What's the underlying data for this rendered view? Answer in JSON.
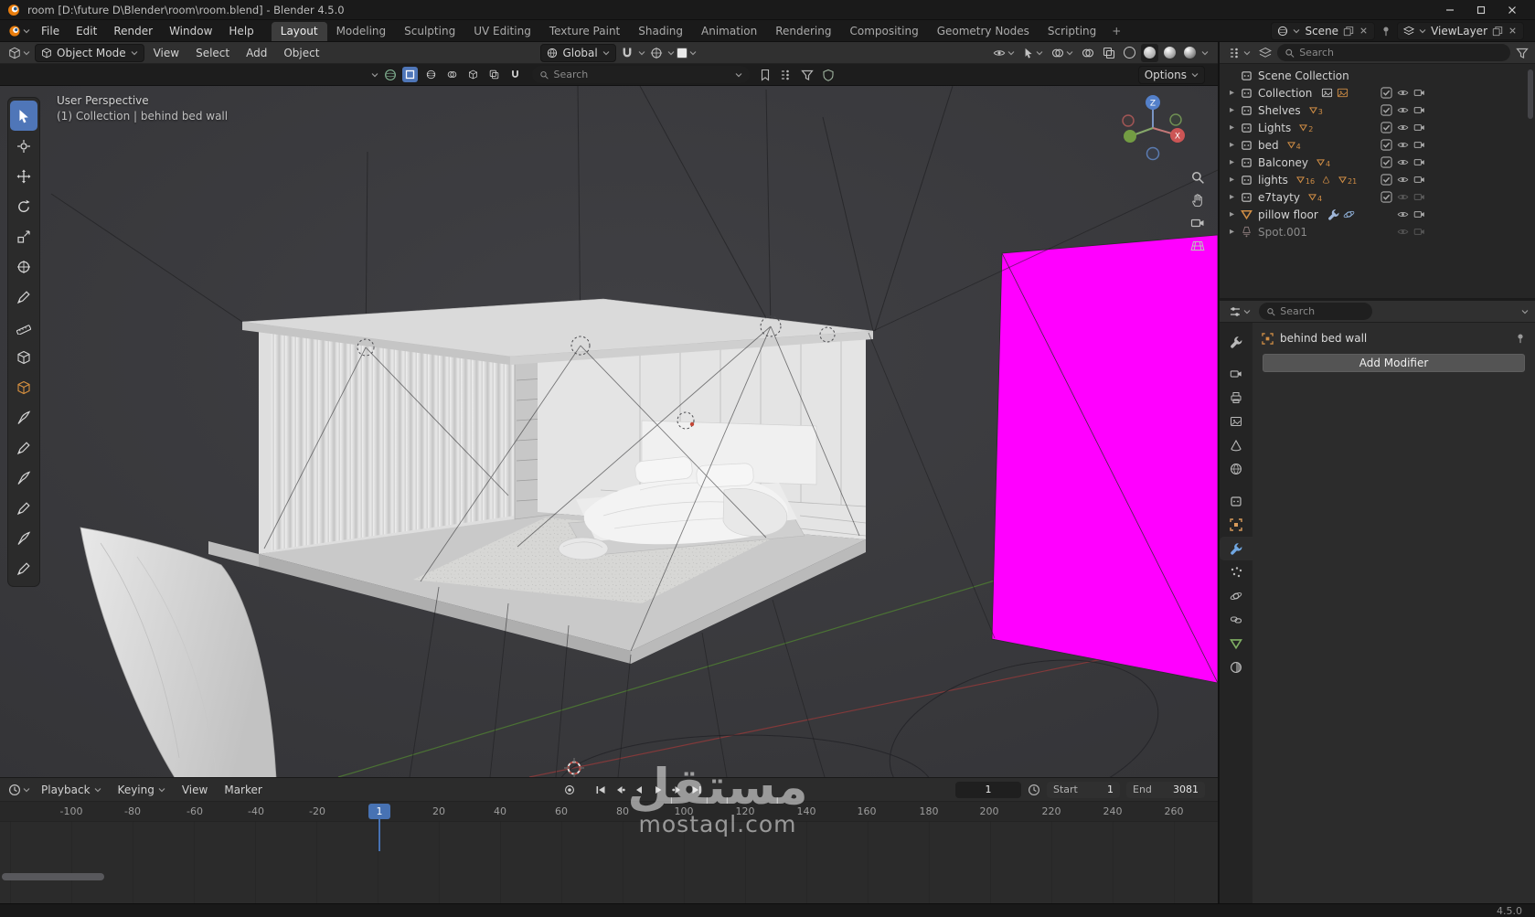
{
  "title_bar": {
    "title": "room [D:\\future D\\Blender\\room\\room.blend] - Blender 4.5.0"
  },
  "menu_bar": {
    "menus": [
      "File",
      "Edit",
      "Render",
      "Window",
      "Help"
    ],
    "workspaces": [
      "Layout",
      "Modeling",
      "Sculpting",
      "UV Editing",
      "Texture Paint",
      "Shading",
      "Animation",
      "Rendering",
      "Compositing",
      "Geometry Nodes",
      "Scripting"
    ],
    "active_workspace": "Layout",
    "add_tab": "+",
    "scene_selector": {
      "label": "Scene"
    },
    "view_layer_selector": {
      "label": "ViewLayer"
    }
  },
  "viewport_header": {
    "mode": "Object Mode",
    "menus": [
      "View",
      "Select",
      "Add",
      "Object"
    ],
    "orientation": "Global"
  },
  "tool_settings": {
    "search_placeholder": "Search",
    "options_label": "Options"
  },
  "viewport": {
    "perspective_label": "User Perspective",
    "context_label": "(1) Collection | behind bed wall",
    "gizmo_axes": {
      "x": "X",
      "z": "Z"
    }
  },
  "outliner": {
    "search_placeholder": "Search",
    "root_label": "Scene Collection",
    "items": [
      {
        "label": "Collection"
      },
      {
        "label": "Shelves",
        "count": "3"
      },
      {
        "label": "Lights",
        "count": "2"
      },
      {
        "label": "bed",
        "count": "4"
      },
      {
        "label": "Balconey",
        "count": "4"
      },
      {
        "label": "lights",
        "count": "16",
        "count2": "21"
      },
      {
        "label": "e7tayty",
        "count": "4"
      },
      {
        "label": "pillow floor"
      },
      {
        "label": "Spot.001"
      }
    ]
  },
  "properties": {
    "search_placeholder": "Search",
    "breadcrumb": "behind bed wall",
    "add_modifier_label": "Add Modifier"
  },
  "timeline": {
    "menus": [
      "Playback",
      "Keying",
      "View",
      "Marker"
    ],
    "current_frame": "1",
    "start_label": "Start",
    "start_value": "1",
    "end_label": "End",
    "end_value": "3081",
    "playhead_label": "1",
    "ticks": [
      "-100",
      "-80",
      "-60",
      "-40",
      "-20",
      "20",
      "40",
      "60",
      "80",
      "100",
      "120",
      "140",
      "160",
      "180",
      "200",
      "220",
      "240",
      "260"
    ]
  },
  "status_bar": {
    "version": "4.5.0"
  },
  "watermark": {
    "arabic": "مستقل",
    "latin": "mostaql.com"
  },
  "colors": {
    "accent": "#4772b3",
    "magenta": "#ff00ff",
    "axis_x": "#8f3a3a",
    "axis_y": "#4f7d33",
    "object_orange": "#cf8d45"
  }
}
